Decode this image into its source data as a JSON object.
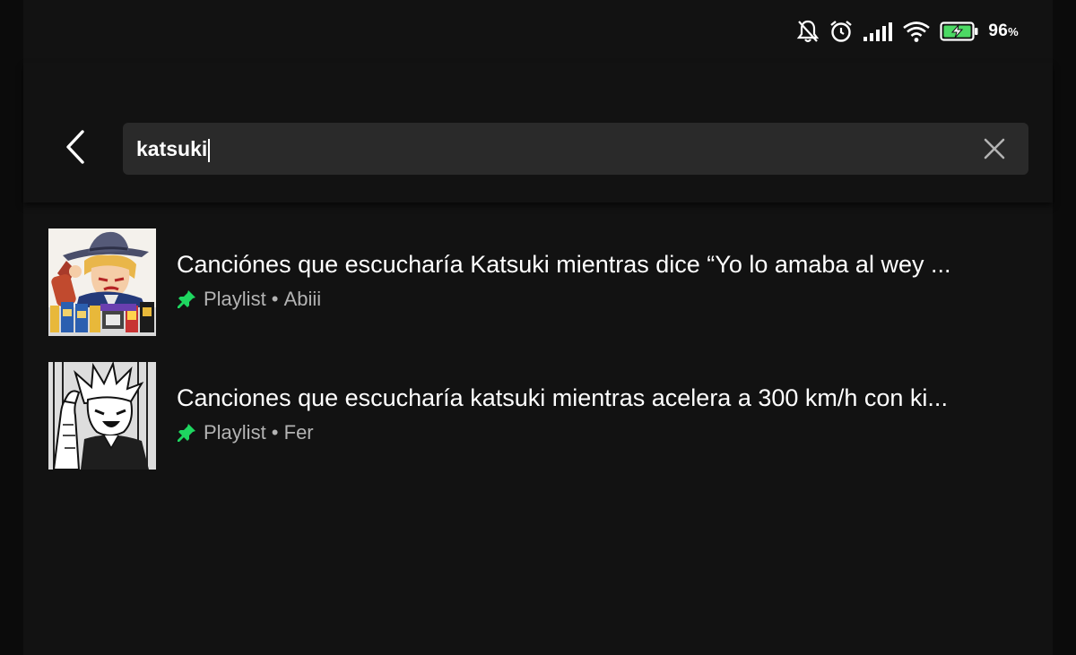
{
  "status_bar": {
    "battery_percent": "96",
    "battery_unit": "%",
    "icons": [
      "bell-off-icon",
      "alarm-icon",
      "signal-icon",
      "wifi-icon",
      "battery-charging-icon"
    ]
  },
  "search": {
    "query": "katsuki",
    "back_icon": "chevron-left-icon",
    "clear_icon": "close-icon"
  },
  "results": [
    {
      "title": "Canciónes que escucharía Katsuki mientras dice “Yo lo amaba al wey ...",
      "type": "Playlist",
      "separator": " • ",
      "owner": "Abiii",
      "pinned": true
    },
    {
      "title": "Canciones que escucharía katsuki mientras acelera a 300 km/h con ki...",
      "type": "Playlist",
      "separator": " • ",
      "owner": "Fer",
      "pinned": true
    }
  ],
  "colors": {
    "background": "#121212",
    "search_box": "#2a2a2a",
    "accent_green": "#1ed760",
    "secondary_text": "#b3b3b3"
  }
}
